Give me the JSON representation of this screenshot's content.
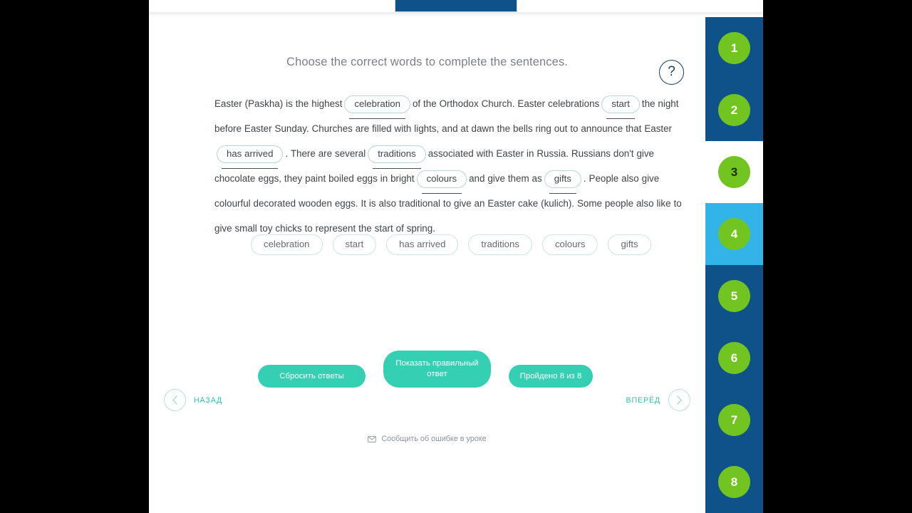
{
  "browser": {
    "tab_placeholder": ""
  },
  "exercise": {
    "title": "Choose the correct words to complete the sentences.",
    "help_label": "?",
    "text_parts": {
      "p1": "Easter (Paskha) is the highest",
      "p2": "of the Orthodox Church. Easter celebrations",
      "p3": "the night before Easter Sunday. Churches are filled with lights, and at dawn the bells ring out to announce that Easter",
      "p4": ". There are several",
      "p5": "associated with Easter in Russia. Russians don't give chocolate eggs, they paint boiled eggs in bright",
      "p6": "and give them as",
      "p7": ". People also give colourful decorated wooden eggs. It is also traditional to give an Easter cake (kulich). Some people also like to give small toy chicks to represent the start of spring."
    },
    "answers": [
      "celebration",
      "start",
      "has arrived",
      "traditions",
      "colours",
      "gifts"
    ],
    "word_bank": [
      "celebration",
      "start",
      "has arrived",
      "traditions",
      "colours",
      "gifts"
    ]
  },
  "actions": {
    "reset_label": "Сбросить ответы",
    "show_answer_label": "Показать правильный ответ",
    "progress_label": "Пройдено 8 из 8"
  },
  "navigation": {
    "prev_label": "НАЗАД",
    "next_label": "ВПЕРЁД"
  },
  "footer": {
    "report_label": "Сообщить об ошибке в уроке"
  },
  "sidebar": {
    "items": [
      {
        "label": "1",
        "state": "default"
      },
      {
        "label": "2",
        "state": "default"
      },
      {
        "label": "3",
        "state": "hover"
      },
      {
        "label": "4",
        "state": "active"
      },
      {
        "label": "5",
        "state": "default"
      },
      {
        "label": "6",
        "state": "default"
      },
      {
        "label": "7",
        "state": "default"
      },
      {
        "label": "8",
        "state": "default"
      }
    ]
  },
  "colors": {
    "sidebar_bg": "#0f5289",
    "sidebar_active": "#33b4e8",
    "badge_green": "#72c521",
    "accent_teal": "#35cfb4",
    "nav_teal": "#2ec4b0",
    "text_grey": "#7b7f86",
    "body_text": "#3e4348"
  }
}
